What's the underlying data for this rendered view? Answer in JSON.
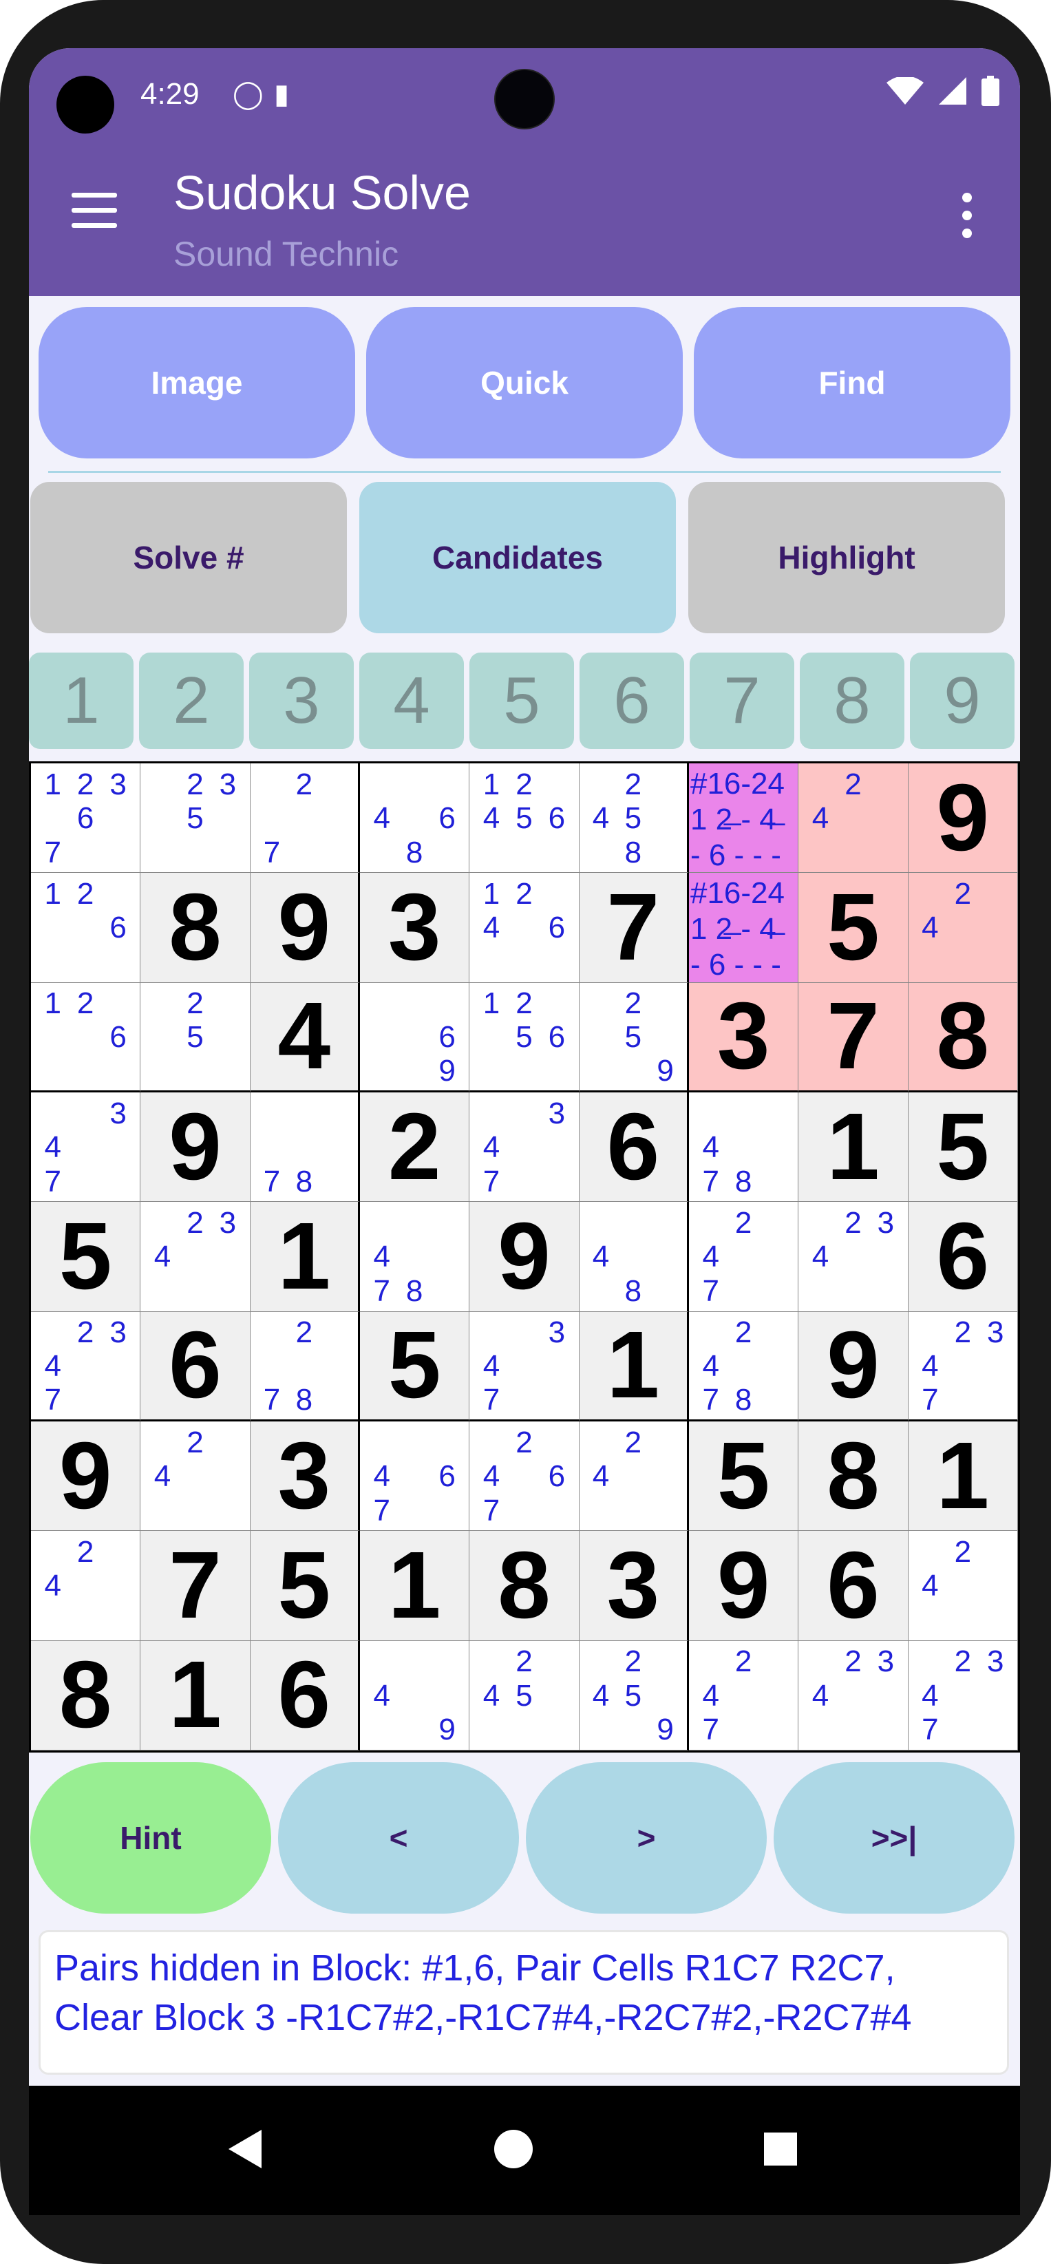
{
  "status": {
    "time": "4:29"
  },
  "app": {
    "title": "Sudoku Solve",
    "subtitle": "Sound Technic"
  },
  "top_buttons": [
    {
      "label": "Image"
    },
    {
      "label": "Quick"
    },
    {
      "label": "Find"
    }
  ],
  "mid_buttons": [
    {
      "label": "Solve #",
      "color": "#c8c8c8"
    },
    {
      "label": "Candidates",
      "color": "#add8e6"
    },
    {
      "label": "Highlight",
      "color": "#c8c8c8"
    }
  ],
  "column_numbers": [
    "1",
    "2",
    "3",
    "4",
    "5",
    "6",
    "7",
    "8",
    "9"
  ],
  "grid": [
    [
      {
        "c": "123 6 7  "
      },
      {
        "c": " 23 5    "
      },
      {
        "c": " 2    7  "
      },
      {
        "c": "   4 6 8 "
      },
      {
        "c": "12 456   "
      },
      {
        "c": " 2 45  8 "
      },
      {
        "p": "#16-24\n1 2̶ - 4̶\n- 6 - - -"
      },
      {
        "c": " 2 4    ",
        "h": "red"
      },
      {
        "v": "9",
        "h": "red"
      }
    ],
    [
      {
        "c": "12   6   "
      },
      {
        "v": "8"
      },
      {
        "v": "9"
      },
      {
        "v": "3"
      },
      {
        "c": "12 4 6   "
      },
      {
        "v": "7"
      },
      {
        "p": "#16-24\n1 2̶ - 4̶\n- 6 - - -"
      },
      {
        "v": "5",
        "h": "red"
      },
      {
        "c": " 2 4     ",
        "h": "red"
      }
    ],
    [
      {
        "c": "12   6   "
      },
      {
        "c": " 2  5    "
      },
      {
        "v": "4"
      },
      {
        "c": "     6  9"
      },
      {
        "c": "12  56   "
      },
      {
        "c": " 2  5   9"
      },
      {
        "v": "3",
        "h": "red"
      },
      {
        "v": "7",
        "h": "red"
      },
      {
        "v": "8",
        "h": "red"
      }
    ],
    [
      {
        "c": "  34  7  "
      },
      {
        "v": "9"
      },
      {
        "c": "      78 "
      },
      {
        "v": "2"
      },
      {
        "c": "  34  7  "
      },
      {
        "v": "6"
      },
      {
        "c": "   4  78 "
      },
      {
        "v": "1"
      },
      {
        "v": "5"
      }
    ],
    [
      {
        "v": "5"
      },
      {
        "c": " 234     "
      },
      {
        "v": "1"
      },
      {
        "c": "   4  78 "
      },
      {
        "v": "9"
      },
      {
        "c": "   4   8 "
      },
      {
        "c": " 2 4  7  "
      },
      {
        "c": " 234     "
      },
      {
        "v": "6"
      }
    ],
    [
      {
        "c": " 234  7  "
      },
      {
        "v": "6"
      },
      {
        "c": " 2    78 "
      },
      {
        "v": "5"
      },
      {
        "c": "  34  7  "
      },
      {
        "v": "1"
      },
      {
        "c": " 2 4  78 "
      },
      {
        "v": "9"
      },
      {
        "c": " 234  7  "
      }
    ],
    [
      {
        "v": "9"
      },
      {
        "c": " 2 4     "
      },
      {
        "v": "3"
      },
      {
        "c": "   4 67  "
      },
      {
        "c": " 2 4 67  "
      },
      {
        "c": " 2 4     "
      },
      {
        "v": "5"
      },
      {
        "v": "8"
      },
      {
        "v": "1"
      }
    ],
    [
      {
        "c": " 2 4     "
      },
      {
        "v": "7"
      },
      {
        "v": "5"
      },
      {
        "v": "1"
      },
      {
        "v": "8"
      },
      {
        "v": "3"
      },
      {
        "v": "9"
      },
      {
        "v": "6"
      },
      {
        "c": " 2 4     "
      }
    ],
    [
      {
        "v": "8"
      },
      {
        "v": "1"
      },
      {
        "v": "6"
      },
      {
        "c": "   4    9"
      },
      {
        "c": " 2 45    "
      },
      {
        "c": " 2 45   9"
      },
      {
        "c": " 2 4  7  "
      },
      {
        "c": " 234     "
      },
      {
        "c": " 234  7  "
      }
    ]
  ],
  "bottom_buttons": [
    {
      "label": "Hint",
      "color": "#98ee92"
    },
    {
      "label": "<",
      "color": "#add8e6"
    },
    {
      "label": ">",
      "color": "#add8e6"
    },
    {
      "label": ">>|",
      "color": "#add8e6"
    }
  ],
  "hint_text": "Pairs hidden in Block: #1,6, Pair Cells R1C7 R2C7, Clear Block 3 -R1C7#2,-R1C7#4,-R2C7#2,-R2C7#4",
  "colors": {
    "appbar": "#6b52a6",
    "candidate": "#2020d8",
    "highlight_red": "#fdc5c5",
    "highlight_pink": "#ea85ea"
  }
}
